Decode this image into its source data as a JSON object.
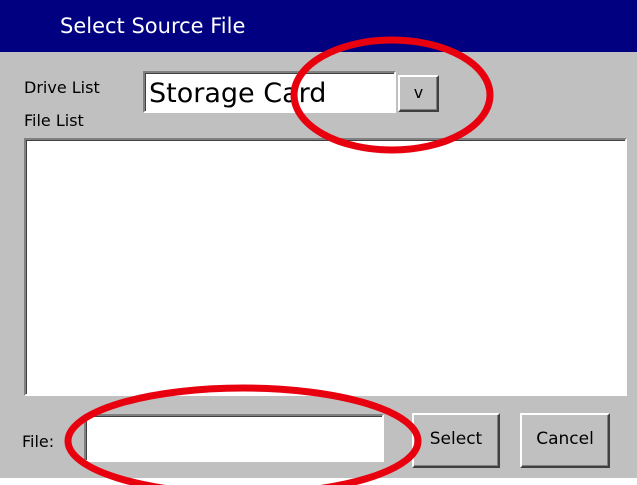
{
  "dialog": {
    "title": "Select Source File"
  },
  "drive": {
    "label": "Drive List",
    "selected": "Storage Card",
    "dropdown_glyph": "v"
  },
  "files": {
    "label": "File List",
    "items": []
  },
  "file_field": {
    "label": "File:",
    "value": ""
  },
  "buttons": {
    "select_label": "Select",
    "cancel_label": "Cancel"
  },
  "annotations": {
    "highlight_color": "#e8000e"
  }
}
